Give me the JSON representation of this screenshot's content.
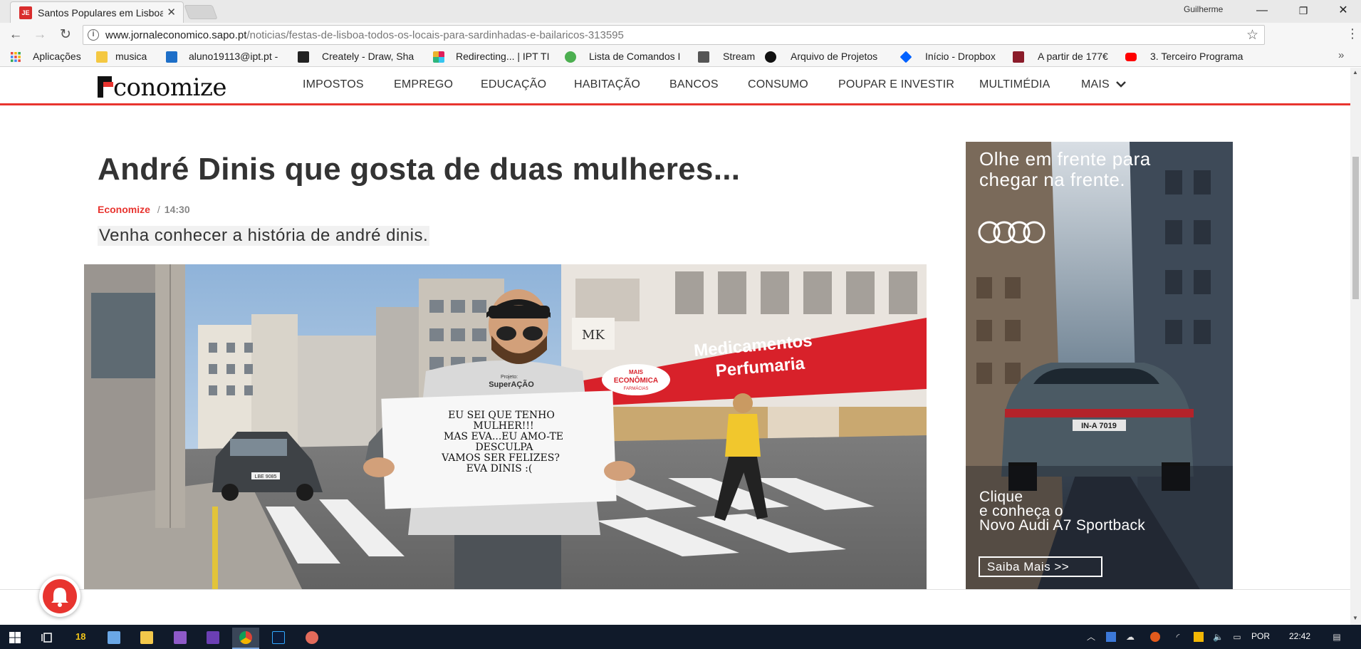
{
  "browser": {
    "tab_title": "Santos Populares em Lisboa: todos os locais",
    "tab_favicon_text": "JE",
    "profile_name": "Guilherme",
    "url_host": "www.jornaleconomico.sapo.pt",
    "url_path": "/noticias/festas-de-lisboa-todos-os-locais-para-sardinhadas-e-bailaricos-313595",
    "window_controls": {
      "minimize": "—",
      "restore": "❐",
      "close": "✕"
    }
  },
  "bookmarks": [
    {
      "label": "Aplicações",
      "icon": "apps-grid-icon",
      "color": "#e8463c"
    },
    {
      "label": "musica",
      "icon": "folder-icon",
      "color": "#f4c842"
    },
    {
      "label": "aluno19113@ipt.pt -",
      "icon": "outlook-icon",
      "color": "#1e6fc8"
    },
    {
      "label": "Creately - Draw, Sha",
      "icon": "lightbulb-icon",
      "color": "#222222"
    },
    {
      "label": "Redirecting... | IPT TI",
      "icon": "slack-icon",
      "color": "#4a154b"
    },
    {
      "label": "Lista de Comandos I",
      "icon": "leaf-icon",
      "color": "#4caf50"
    },
    {
      "label": "Stream",
      "icon": "stream-icon",
      "color": "#333333"
    },
    {
      "label": "Arquivo de Projetos",
      "icon": "tripadvisor-icon",
      "color": "#111111"
    },
    {
      "label": "Início - Dropbox",
      "icon": "dropbox-icon",
      "color": "#0061ff"
    },
    {
      "label": "A partir de 177€",
      "icon": "ticket-icon",
      "color": "#8b1c2a"
    },
    {
      "label": "3. Terceiro Programa",
      "icon": "youtube-icon",
      "color": "#ff0000"
    }
  ],
  "site": {
    "logo_word": "conomize",
    "nav": [
      "IMPOSTOS",
      "EMPREGO",
      "EDUCAÇÃO",
      "HABITAÇÃO",
      "BANCOS",
      "CONSUMO",
      "POUPAR E INVESTIR",
      "MULTIMÉDIA",
      "MAIS"
    ],
    "nav_more_icon": "chevron-down-icon",
    "accent_color": "#e8342f"
  },
  "article": {
    "headline": "André Dinis que gosta de duas mulheres...",
    "category": "Economize",
    "separator": "/",
    "time": "14:30",
    "lead": "Venha conhecer a história de andré dinis.",
    "photo": {
      "sign_lines": [
        "EU SEI QUE TENHO",
        "MULHER!!!",
        "MAS EVA...EU AMO-TE",
        "DESCULPA",
        "VAMOS SER FELIZES?",
        "EVA DINIS :("
      ],
      "shirt_small": "Projeto:",
      "shirt_text": "SuperAÇÃO",
      "store_sign_1": "Medicamentos",
      "store_sign_2": "Perfumaria",
      "store_logo_1": "MAIS",
      "store_logo_2": "ECONÔMICA",
      "store_logo_3": "FARMÁCIAS",
      "billboard": "MK",
      "plate": "LBE 9085"
    }
  },
  "ad": {
    "headline": "Olhe em frente para chegar na frente.",
    "brand_icon": "audi-rings-icon",
    "plate": "IN-A 7019",
    "cta_lines": [
      "Clique",
      "e conheça o",
      "Novo Audi A7 Sportback"
    ],
    "button": "Saiba Mais >>"
  },
  "taskbar": {
    "badge": "18",
    "language": "POR",
    "clock": "22:42",
    "apps": [
      "windows-start-icon",
      "task-view-icon",
      "badge-18",
      "3d-box-icon",
      "file-explorer-icon",
      "visual-studio-icon",
      "visual-studio-2-icon",
      "chrome-icon",
      "photoshop-icon",
      "paint-icon"
    ]
  }
}
